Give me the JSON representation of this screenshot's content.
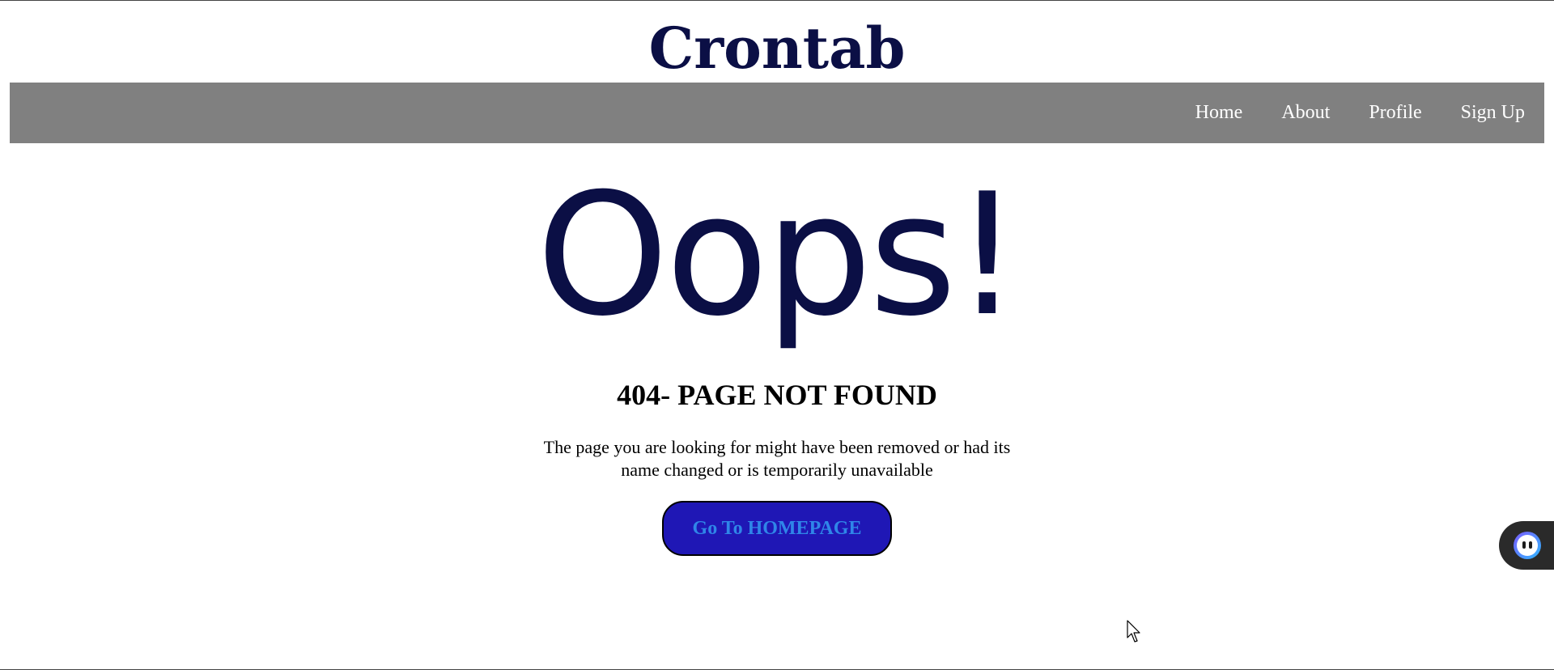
{
  "header": {
    "brand": "Crontab"
  },
  "nav": {
    "items": [
      {
        "label": "Home"
      },
      {
        "label": "About"
      },
      {
        "label": "Profile"
      },
      {
        "label": "Sign Up"
      }
    ]
  },
  "error": {
    "headline": "Oops!",
    "code_title": "404- PAGE NOT FOUND",
    "message": "The page you are looking for might have been removed or had its name changed or is temporarily unavailable",
    "button_label": "Go To HOMEPAGE"
  },
  "colors": {
    "brand": "#0b0f45",
    "navbar": "#808080",
    "button_bg": "#1f17b5",
    "button_text": "#2f86e8"
  },
  "icons": {
    "widget": "assistant-bot-icon",
    "cursor": "mouse-pointer-icon"
  }
}
